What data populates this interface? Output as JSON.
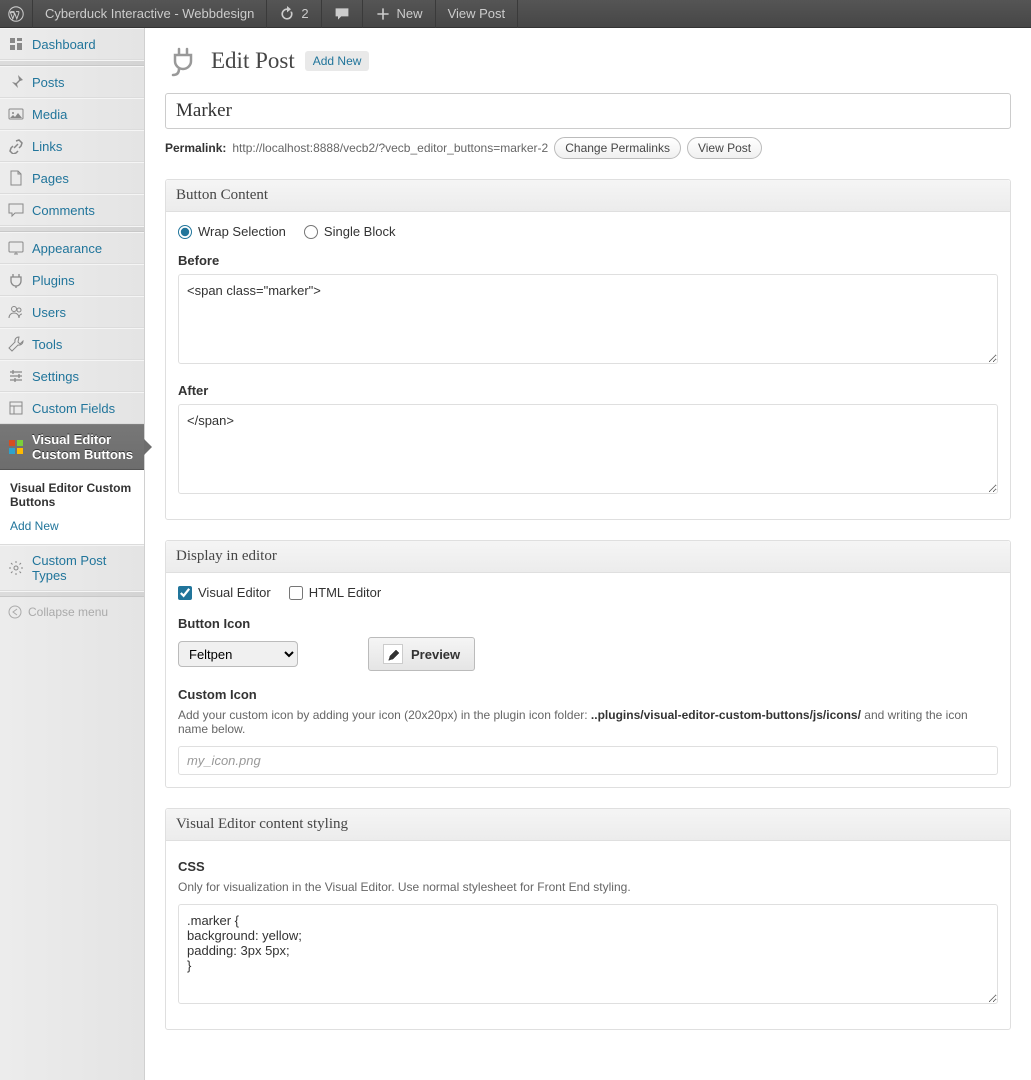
{
  "adminbar": {
    "site_name": "Cyberduck Interactive - Webbdesign",
    "updates_count": "2",
    "new_label": "New",
    "view_post": "View Post"
  },
  "sidebar": {
    "dashboard": "Dashboard",
    "posts": "Posts",
    "media": "Media",
    "links": "Links",
    "pages": "Pages",
    "comments": "Comments",
    "appearance": "Appearance",
    "plugins": "Plugins",
    "users": "Users",
    "tools": "Tools",
    "settings": "Settings",
    "custom_fields": "Custom Fields",
    "vecb": "Visual Editor Custom Buttons",
    "vecb_sub1": "Visual Editor Custom Buttons",
    "vecb_sub2": "Add New",
    "custom_post_types": "Custom Post Types",
    "collapse": "Collapse menu"
  },
  "header": {
    "title": "Edit Post",
    "add_new": "Add New"
  },
  "post": {
    "title": "Marker",
    "permalink_label": "Permalink:",
    "permalink_url": "http://localhost:8888/vecb2/?vecb_editor_buttons=marker-2",
    "change_permalinks": "Change Permalinks",
    "view_post": "View Post"
  },
  "box_content": {
    "heading": "Button Content",
    "wrap": "Wrap Selection",
    "single": "Single Block",
    "before_label": "Before",
    "before_value": "<span class=\"marker\">",
    "after_label": "After",
    "after_value": "</span>"
  },
  "box_display": {
    "heading": "Display in editor",
    "visual": "Visual Editor",
    "html": "HTML Editor",
    "icon_label": "Button Icon",
    "icon_selected": "Feltpen",
    "preview": "Preview",
    "custom_icon_label": "Custom Icon",
    "custom_icon_desc_pre": "Add your custom icon by adding your icon (20x20px) in the plugin icon folder: ",
    "custom_icon_desc_path": "..plugins/visual-editor-custom-buttons/js/icons/",
    "custom_icon_desc_post": " and writing the icon name below.",
    "custom_icon_placeholder": "my_icon.png"
  },
  "box_styling": {
    "heading": "Visual Editor content styling",
    "css_label": "CSS",
    "css_desc": "Only for visualization in the Visual Editor. Use normal stylesheet for Front End styling.",
    "css_value": ".marker {\nbackground: yellow;\npadding: 3px 5px;\n}"
  }
}
